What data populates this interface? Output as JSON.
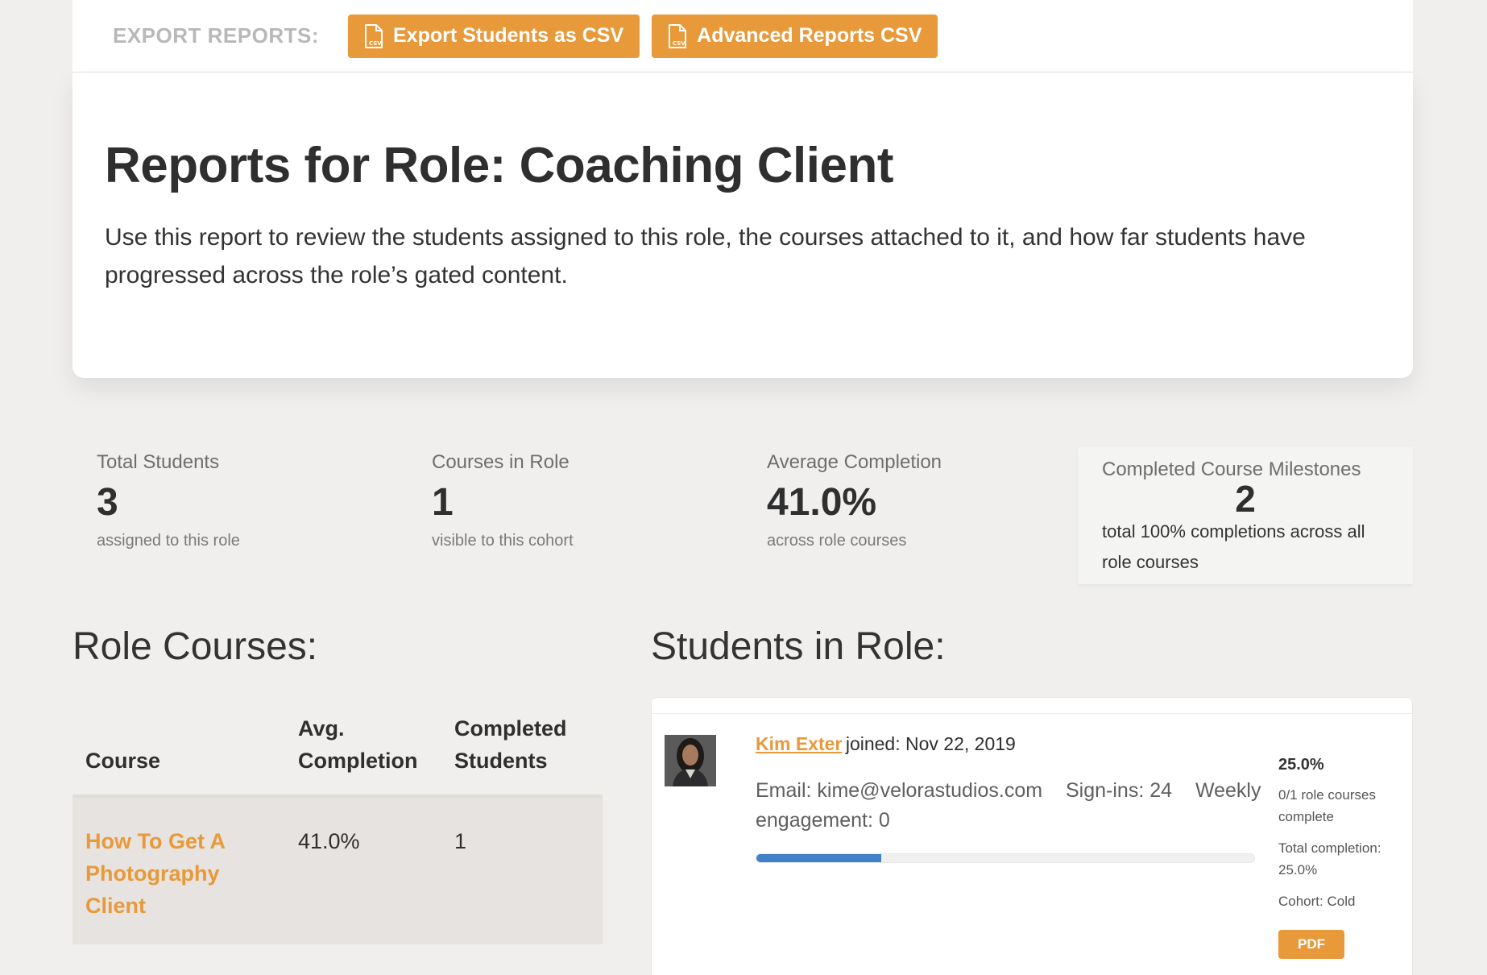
{
  "export": {
    "label": "EXPORT REPORTS:",
    "buttons": [
      {
        "label": "Export Students as CSV",
        "icon": "csv-file-icon"
      },
      {
        "label": "Advanced Reports CSV",
        "icon": "csv-file-icon"
      }
    ]
  },
  "hero": {
    "title": "Reports for Role: Coaching Client",
    "description": "Use this report to review the students assigned to this role, the courses attached to it, and how far students have progressed across the role’s gated content."
  },
  "stats": [
    {
      "label": "Total Students",
      "value": "3",
      "sub": "assigned to this role"
    },
    {
      "label": "Courses in Role",
      "value": "1",
      "sub": "visible to this cohort"
    },
    {
      "label": "Average Completion",
      "value": "41.0%",
      "sub": "across role courses"
    },
    {
      "label": "Completed Course Milestones",
      "value": "2",
      "sub": "total 100% completions across all role courses"
    }
  ],
  "courses": {
    "title": "Role Courses:",
    "headers": [
      "Course",
      "Avg. Completion",
      "Completed Students"
    ],
    "rows": [
      {
        "course": "How To Get A Photography Client",
        "avg": "41.0%",
        "completed": "1"
      }
    ]
  },
  "students": {
    "title": "Students in Role:",
    "items": [
      {
        "name": "Kim Exter",
        "joined": "joined: Nov 22, 2019",
        "email": "Email: kime@velorastudios.com",
        "signins": "Sign-ins: 24",
        "engagement": "Weekly engagement: 0",
        "progress": 0.25,
        "pct": "25.0%",
        "courses_complete": "0/1 role courses complete",
        "total_completion": "Total completion: 25.0%",
        "cohort": "Cohort: Cold",
        "pdf": "PDF"
      }
    ]
  },
  "colors": {
    "accent": "#e8993a",
    "progress": "#3f82c8"
  }
}
